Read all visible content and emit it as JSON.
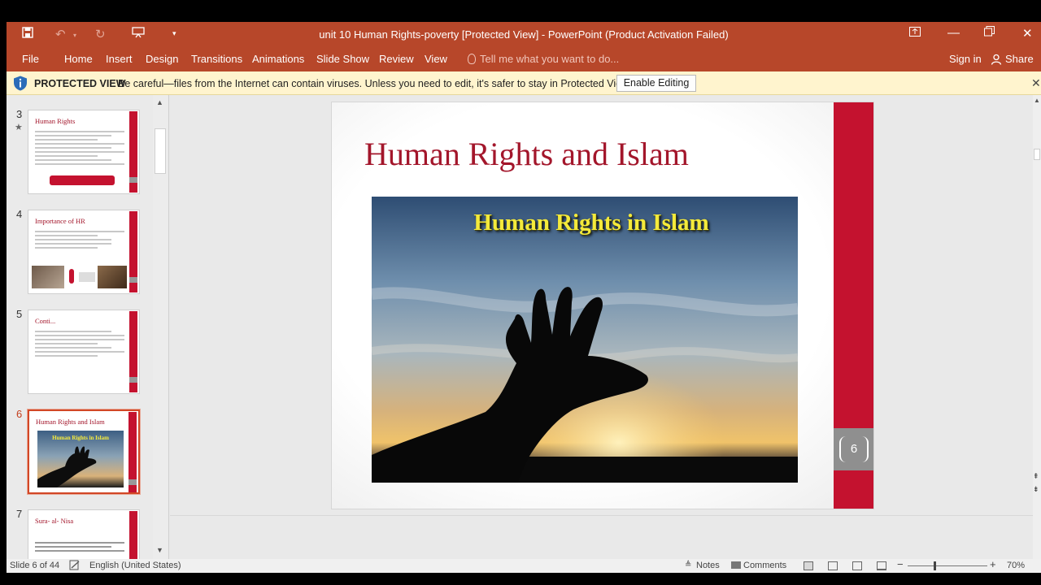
{
  "window": {
    "title": "unit 10 Human Rights-poverty [Protected View] - PowerPoint (Product Activation Failed)",
    "buttons": [
      "ribbon-display-icon",
      "minimize-icon",
      "restore-icon",
      "close-icon"
    ]
  },
  "ribbon": {
    "tabs": [
      "File",
      "Home",
      "Insert",
      "Design",
      "Transitions",
      "Animations",
      "Slide Show",
      "Review",
      "View"
    ],
    "tell_me": "Tell me what you want to do...",
    "sign_in": "Sign in",
    "share": "Share"
  },
  "protected_view": {
    "label": "PROTECTED VIEW",
    "message": "Be careful—files from the Internet can contain viruses. Unless you need to edit, it's safer to stay in Protected View.",
    "button": "Enable Editing"
  },
  "thumbnails": [
    {
      "number": "3",
      "title": "Human Rights",
      "starred": true,
      "selected": false
    },
    {
      "number": "4",
      "title": "Importance of HR",
      "starred": false,
      "selected": false
    },
    {
      "number": "5",
      "title": "Conti...",
      "starred": false,
      "selected": false
    },
    {
      "number": "6",
      "title": "Human Rights and Islam",
      "image_caption": "Human Rights in Islam",
      "starred": false,
      "selected": true
    },
    {
      "number": "7",
      "title": "Sura- al- Nisa",
      "starred": false,
      "selected": false
    }
  ],
  "slide": {
    "title": "Human Rights and Islam",
    "image_caption": "Human Rights in Islam",
    "number": "6"
  },
  "status": {
    "slide_info": "Slide 6 of 44",
    "language": "English (United States)",
    "notes": "Notes",
    "comments": "Comments",
    "zoom": "70%"
  },
  "colors": {
    "accent": "#b7472a",
    "slide_red": "#c4122f",
    "title_red": "#a3162b",
    "caption_yellow": "#f4ea3b"
  }
}
